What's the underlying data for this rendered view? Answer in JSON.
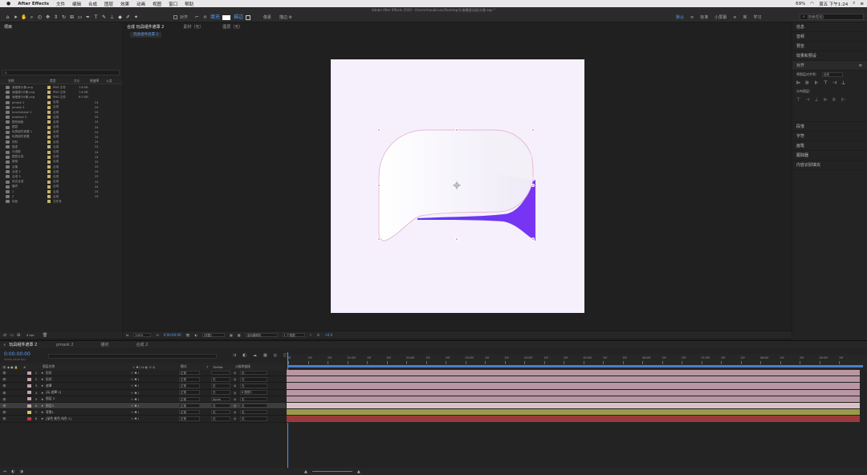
{
  "menubar": {
    "app": "After Effects",
    "items": [
      "文件",
      "编辑",
      "合成",
      "图层",
      "效果",
      "动画",
      "视图",
      "窗口",
      "帮助"
    ],
    "title": "Adobe After Effects 2020 - /Users/moubiruan/Desktop/头像雕塑动画/头像.aep *",
    "clock": "周五 下午1:24",
    "battery": "69%"
  },
  "toolbar": {
    "align_label": "对齐",
    "workspaces": [
      {
        "label": "默认",
        "active": false
      },
      {
        "label": "描边",
        "active": true
      },
      {
        "label": "像素",
        "active": false
      },
      {
        "label": "描边 ⚙",
        "active": false
      }
    ],
    "ws_right": [
      "默认",
      "≡",
      "标准",
      "小屏幕",
      "≡",
      "库",
      "学习"
    ],
    "help_search": "搜索帮助"
  },
  "project": {
    "tab": "项目",
    "search_placeholder": "",
    "columns": [
      "名称",
      "类型",
      "大小",
      "帧速率",
      "入点"
    ],
    "items": [
      {
        "name": "我爱美头像.png",
        "type": "PNG 文件",
        "size": "1.8 KB",
        "fps": "",
        "color": "#c8b46a"
      },
      {
        "name": "我爱美2头像.png",
        "type": "PNG 文件",
        "size": "7.6 KB",
        "fps": "",
        "color": "#c8b46a"
      },
      {
        "name": "我爱美3头像.png",
        "type": "PNG 文件",
        "size": "6.9 KB",
        "fps": "",
        "color": "#c8b46a"
      },
      {
        "name": "pmask 2",
        "type": "合成",
        "size": "",
        "fps": "24",
        "color": "#c8b46a"
      },
      {
        "name": "pmask 3",
        "type": "合成",
        "size": "",
        "fps": "24",
        "color": "#c8b46a"
      },
      {
        "name": "touchshape 1",
        "type": "合成",
        "size": "",
        "fps": "24",
        "color": "#c8b46a"
      },
      {
        "name": "torplace 3",
        "type": "合成",
        "size": "",
        "fps": "24",
        "color": "#c8b46a"
      },
      {
        "name": "图形画板",
        "type": "合成",
        "size": "",
        "fps": "24",
        "color": "#c8b46a"
      },
      {
        "name": "图层",
        "type": "合成",
        "size": "",
        "fps": "24",
        "color": "#c8b46a"
      },
      {
        "name": "玩具组件遮罩 1",
        "type": "合成",
        "size": "",
        "fps": "24",
        "color": "#c8b46a"
      },
      {
        "name": "玩具组件遮罩",
        "type": "合成",
        "size": "",
        "fps": "24",
        "color": "#c8b46a"
      },
      {
        "name": "材料",
        "type": "合成",
        "size": "",
        "fps": "24",
        "color": "#c8b46a"
      },
      {
        "name": "描述",
        "type": "合成",
        "size": "",
        "fps": "24",
        "color": "#c8b46a"
      },
      {
        "name": "分选框",
        "type": "合成",
        "size": "",
        "fps": "24",
        "color": "#c8b46a"
      },
      {
        "name": "图层合成",
        "type": "合成",
        "size": "",
        "fps": "24",
        "color": "#c8b46a"
      },
      {
        "name": "新组",
        "type": "合成",
        "size": "",
        "fps": "25",
        "color": "#c8b46a"
      },
      {
        "name": "合集",
        "type": "合成",
        "size": "",
        "fps": "24",
        "color": "#c8b46a"
      },
      {
        "name": "合成 2",
        "type": "合成",
        "size": "",
        "fps": "24",
        "color": "#c8b46a"
      },
      {
        "name": "合成 3",
        "type": "合成",
        "size": "",
        "fps": "25",
        "color": "#c8b46a"
      },
      {
        "name": "综合合成",
        "type": "合成",
        "size": "",
        "fps": "24",
        "color": "#c8b46a"
      },
      {
        "name": "最终",
        "type": "合成",
        "size": "",
        "fps": "24",
        "color": "#c8b46a"
      },
      {
        "name": "1",
        "type": "合成",
        "size": "",
        "fps": "24",
        "color": "#c8b46a"
      },
      {
        "name": "2",
        "type": "合成",
        "size": "",
        "fps": "24",
        "color": "#c8b46a"
      },
      {
        "name": "纯色",
        "type": "文件夹",
        "size": "",
        "fps": "",
        "color": "#c8b46a"
      }
    ],
    "bpc": "8 bpc"
  },
  "comp": {
    "tabs": [
      {
        "label": "合成 玩具组件遮罩 2",
        "active": true
      },
      {
        "label": "素材（无）",
        "active": false
      },
      {
        "label": "图层（无）",
        "active": false
      }
    ],
    "subtab": "玩具组件遮罩 2",
    "viewer": {
      "zoom": "100%",
      "time": "0:00:00:00",
      "quality": "(完整)",
      "camera": "活动摄像机",
      "views": "1 个视图",
      "exposure": "+0.0"
    }
  },
  "right": {
    "items": [
      "信息",
      "音频",
      "预览",
      "效果和预设",
      "对齐",
      "段落",
      "字符",
      "画笔",
      "跟踪器",
      "内容识别填充"
    ],
    "align_label": "将图层对齐到：",
    "align_value": "合成",
    "distribute_label": "分布图层："
  },
  "timeline": {
    "tabs": [
      {
        "label": "玩具组件遮罩 2",
        "active": true
      },
      {
        "label": "pmask 2",
        "active": false
      },
      {
        "label": "描状",
        "active": false
      },
      {
        "label": "合成 2",
        "active": false
      }
    ],
    "time": "0:00:00:00",
    "time_sub": "00000 (24.00 fps)",
    "col_layer": "图层名称",
    "col_mode": "模式",
    "col_trk": "TrkMat",
    "col_parent": "父级和链接",
    "ruler": [
      "0f",
      "10f",
      "20f",
      "01:00f",
      "10f",
      "20f",
      "02:00f",
      "10f",
      "20f",
      "03:00f",
      "10f",
      "20f",
      "04:00f",
      "10f",
      "20f",
      "05:00f",
      "10f",
      "20f",
      "06:00f",
      "10f",
      "20f",
      "07:00f",
      "10f",
      "20f",
      "08:00f",
      "10f",
      "20f",
      "09:00f",
      "10f"
    ],
    "layers": [
      {
        "num": "1",
        "name": "形状",
        "mode": "正常",
        "trk": "",
        "parent": "无",
        "color": "#c4a3ae",
        "bar": "#b896a3"
      },
      {
        "num": "2",
        "name": "形状",
        "mode": "正常",
        "trk": "无",
        "parent": "无",
        "color": "#c4a3ae",
        "bar": "#b896a3"
      },
      {
        "num": "3",
        "name": "遮罩",
        "mode": "正常",
        "trk": "无",
        "parent": "无",
        "color": "#c4a3ae",
        "bar": "#b896a3"
      },
      {
        "num": "4",
        "name": "[玩 遮罩 2]",
        "mode": "正常",
        "trk": "无",
        "parent": "6 图层3",
        "color": "#c4a3ae",
        "bar": "#b896a3"
      },
      {
        "num": "5",
        "name": "图层 3",
        "mode": "正常",
        "trk": "Alpha",
        "parent": "无",
        "color": "#c4a3ae",
        "bar": "#b896a3"
      },
      {
        "num": "6",
        "name": "图层3",
        "mode": "正常",
        "trk": "无",
        "parent": "无",
        "color": "#c4a3ae",
        "bar": "#d9c0c4",
        "selected": true
      },
      {
        "num": "7",
        "name": "背景1",
        "mode": "正常",
        "trk": "无",
        "parent": "无",
        "color": "#d4c657",
        "bar": "#9a9a4a"
      },
      {
        "num": "8",
        "name": "[渐色 紫色 纯色 1]",
        "mode": "正常",
        "trk": "无",
        "parent": "无",
        "color": "#c0393c",
        "bar": "#9b3a3d"
      }
    ]
  }
}
